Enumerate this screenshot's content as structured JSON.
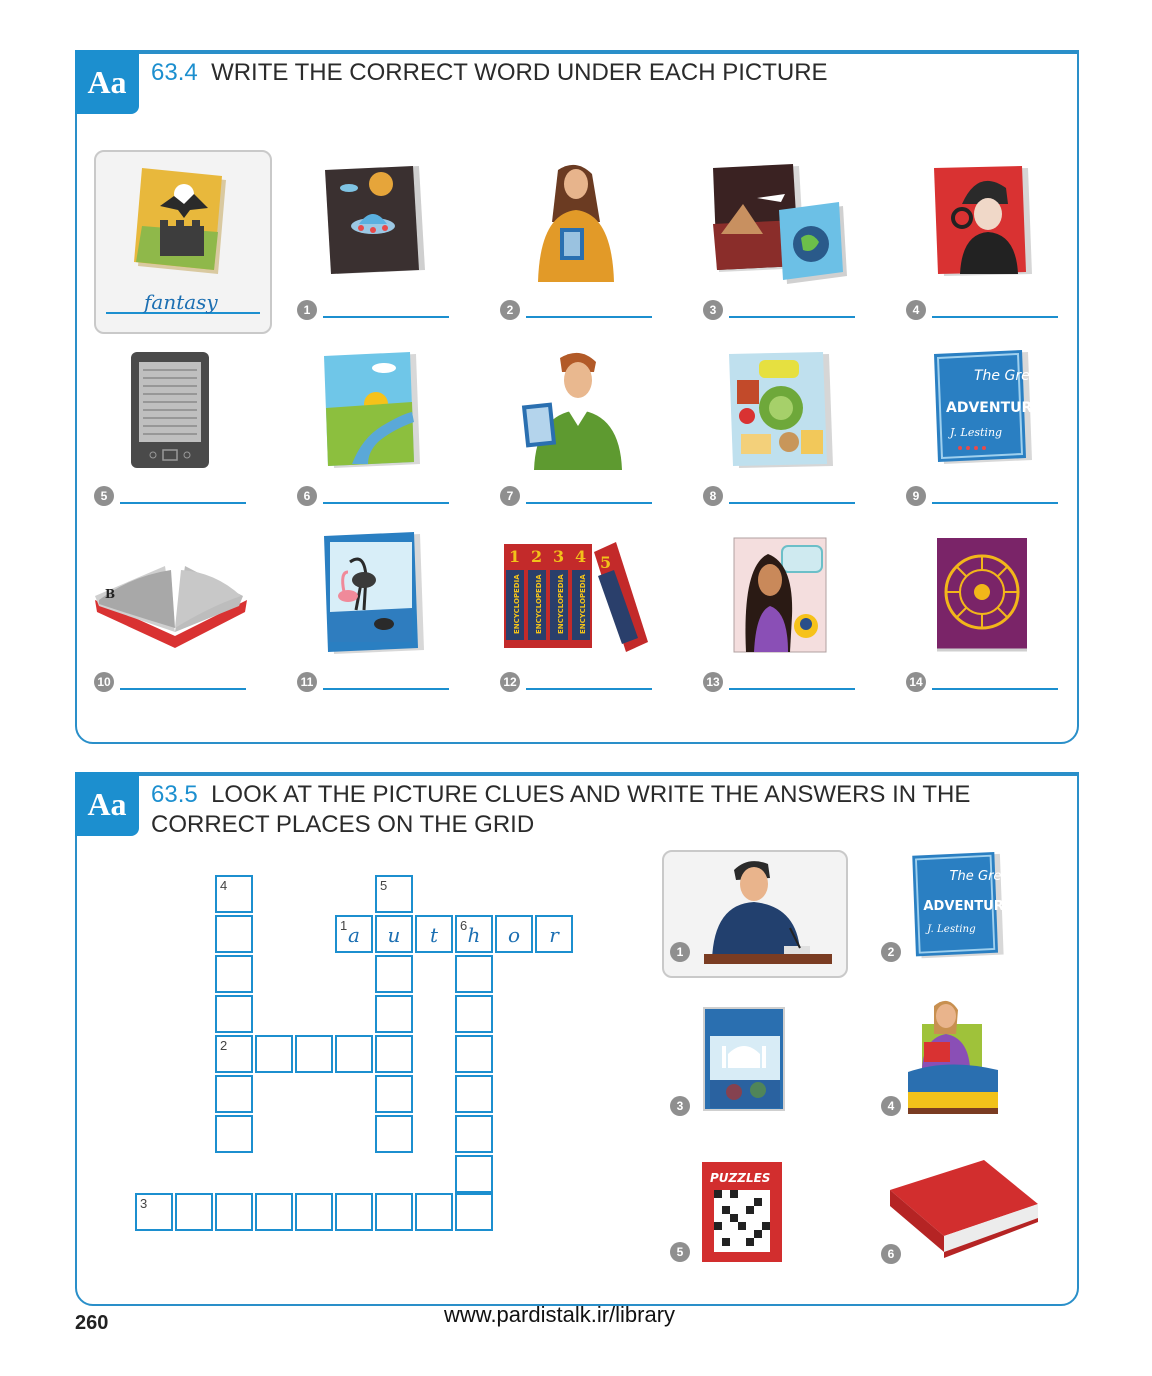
{
  "exercise1": {
    "badge": "Aa",
    "number": "63.4",
    "title": "WRITE THE CORRECT WORD UNDER EACH PICTURE",
    "example_answer": "fantasy",
    "items": [
      {
        "n": "1",
        "icon": "sci-fi-book-icon"
      },
      {
        "n": "2",
        "icon": "woman-holding-book-icon"
      },
      {
        "n": "3",
        "icon": "travel-books-icon"
      },
      {
        "n": "4",
        "icon": "detective-book-icon"
      },
      {
        "n": "5",
        "icon": "e-reader-icon"
      },
      {
        "n": "6",
        "icon": "landscape-book-icon"
      },
      {
        "n": "7",
        "icon": "man-holding-photo-icon"
      },
      {
        "n": "8",
        "icon": "cookbook-icon"
      },
      {
        "n": "9",
        "icon": "adventure-book-icon"
      },
      {
        "n": "10",
        "icon": "open-dictionary-icon"
      },
      {
        "n": "11",
        "icon": "nature-book-icon"
      },
      {
        "n": "12",
        "icon": "encyclopedia-set-icon"
      },
      {
        "n": "13",
        "icon": "biography-book-icon"
      },
      {
        "n": "14",
        "icon": "horoscope-book-icon"
      }
    ],
    "book_text": {
      "great": "The Great",
      "adventure": "ADVENTURE",
      "author_sig": "J. Lesting",
      "dict_letter": "B",
      "encyclopedia": "ENCYCLOPEDIA",
      "volumes": [
        "1",
        "2",
        "3",
        "4",
        "5"
      ]
    }
  },
  "exercise2": {
    "badge": "Aa",
    "number": "63.5",
    "title_line1": "LOOK AT THE PICTURE CLUES AND WRITE THE ANSWERS IN THE",
    "title_line2": "CORRECT PLACES ON THE GRID",
    "grid_numbers": {
      "n1": "1",
      "n2": "2",
      "n3": "3",
      "n4": "4",
      "n5": "5",
      "n6": "6"
    },
    "example_letters": [
      "a",
      "u",
      "t",
      "h",
      "o",
      "r"
    ],
    "clues": [
      {
        "n": "1",
        "icon": "author-writing-icon"
      },
      {
        "n": "2",
        "icon": "adventure-book-icon"
      },
      {
        "n": "3",
        "icon": "travel-guide-icon"
      },
      {
        "n": "4",
        "icon": "reader-in-bed-icon"
      },
      {
        "n": "5",
        "icon": "puzzle-book-icon"
      },
      {
        "n": "6",
        "icon": "hardback-book-icon"
      }
    ],
    "puzzles_label": "PUZZLES"
  },
  "footer": {
    "page_number": "260",
    "url": "www.pardistalk.ir/library"
  }
}
